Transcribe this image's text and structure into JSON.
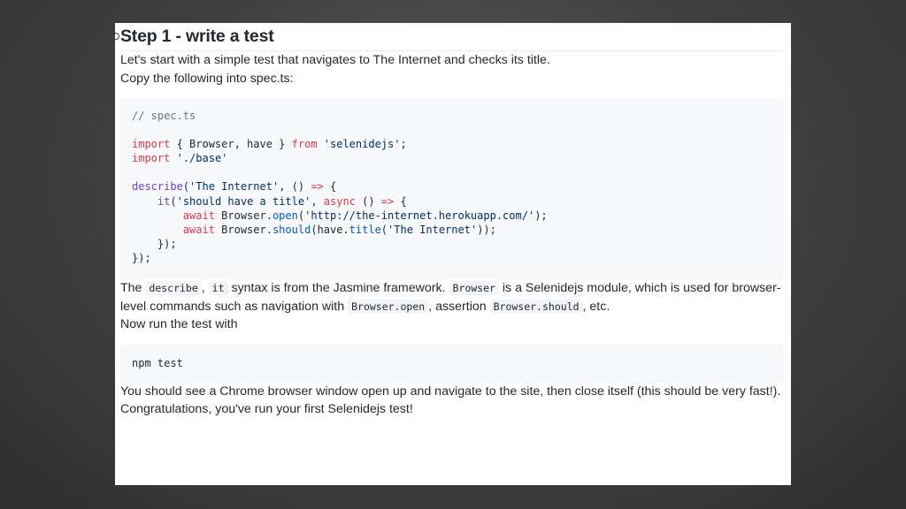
{
  "doc": {
    "heading": "Step 1 - write a test",
    "intro": "Let's start with a simple test that navigates to The Internet and checks its title.",
    "copy_instruction": "Copy the following into spec.ts:",
    "code": {
      "comment": "// spec.ts",
      "line_import1_kw": "import",
      "line_import1_mid": " { Browser, have } ",
      "line_import1_from": "from",
      "line_import1_space": " ",
      "line_import1_str": "'selenidejs'",
      "line_import1_end": ";",
      "line_import2_kw": "import",
      "line_import2_space": " ",
      "line_import2_str": "'./base'",
      "describe_fn": "describe",
      "describe_open": "(",
      "describe_str": "'The Internet'",
      "describe_mid": ", () ",
      "describe_arrow": "=>",
      "describe_end": " {",
      "it_indent": "    ",
      "it_fn": "it",
      "it_open": "(",
      "it_str": "'should have a title'",
      "it_comma": ", ",
      "it_async": "async",
      "it_mid": " () ",
      "it_arrow": "=>",
      "it_end": " {",
      "await_indent": "        ",
      "await1_kw": "await",
      "await1_obj": " Browser.",
      "await1_method": "open",
      "await1_open": "(",
      "await1_str": "'http://the-internet.herokuapp.com/'",
      "await1_end": ");",
      "await2_kw": "await",
      "await2_obj": " Browser.",
      "await2_method": "should",
      "await2_mid": "(have.",
      "await2_fn": "title",
      "await2_open": "(",
      "await2_str": "'The Internet'",
      "await2_end": "));",
      "close_inner": "    });",
      "close_outer": "});"
    },
    "explain_the": "The ",
    "explain_describe": "describe",
    "explain_comma": ", ",
    "explain_it": "it",
    "explain_mid1": " syntax is from the Jasmine framework. ",
    "explain_browser": "Browser",
    "explain_mid2": " is a Selenidejs module, which is used for browser-level commands such as navigation with ",
    "explain_browser_open": "Browser.open",
    "explain_mid3": ", assertion ",
    "explain_browser_should": "Browser.should",
    "explain_end": ", etc.",
    "run_instruction": "Now run the test with",
    "run_command": "npm test",
    "result": "You should see a Chrome browser window open up and navigate to the site, then close itself (this should be very fast!). Congratulations, you've run your first Selenidejs test!"
  }
}
